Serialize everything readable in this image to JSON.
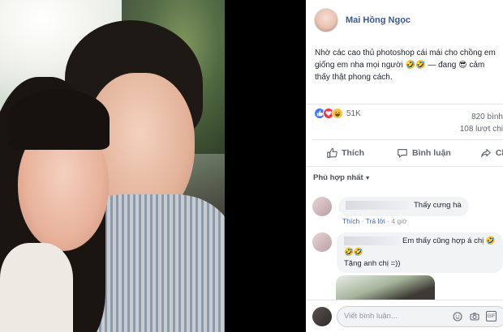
{
  "post": {
    "author": "Mai Hồng Ngọc",
    "caption_line1": "Nhờ các cao thủ photoshop cái mái cho chồng em",
    "caption_line2a": "giống em nha mọi người 🤣🤣 — đang 😎 cảm",
    "caption_line3": "thấy thật phong cách.",
    "reaction_count": "51K",
    "comments_count": "820 bình",
    "shares_count": "108 lượt chi"
  },
  "actions": {
    "like": "Thích",
    "comment": "Bình luận",
    "share": "Chia s"
  },
  "sort_label": "Phù hợp nhất",
  "comments": [
    {
      "text": "Thấy cưng hà",
      "like_label": "Thích",
      "reply_label": "Trả lời",
      "time": "4 giờ"
    },
    {
      "text_line1": "Em thấy cũng hợp á chị 🤣",
      "text_line2": "🤣🤣",
      "text_line3": "Tặng anh chị =))"
    }
  ],
  "composer": {
    "placeholder": "Viết bình luận..."
  },
  "icons": [
    "like-icon",
    "love-icon",
    "haha-icon",
    "thumb-icon",
    "comment-icon",
    "share-icon",
    "emoji-icon",
    "camera-icon",
    "gif-icon"
  ]
}
